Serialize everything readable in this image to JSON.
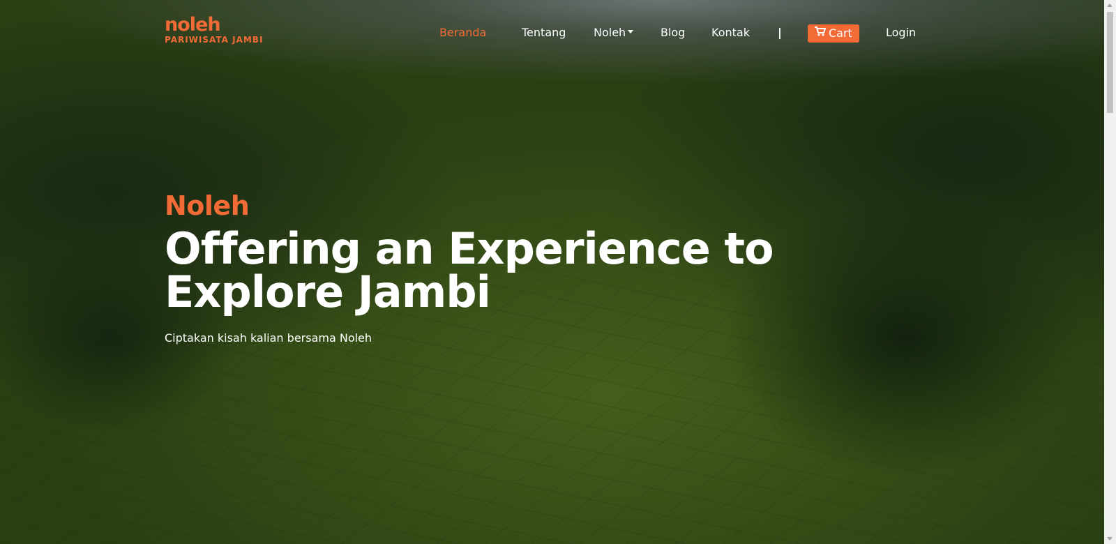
{
  "brand": {
    "logo_word": "noleh",
    "logo_sub": "PARIWISATA JAMBI",
    "accent_color": "#f26b37"
  },
  "nav": {
    "items": [
      {
        "label": "Beranda",
        "active": true
      },
      {
        "label": "Tentang",
        "active": false
      },
      {
        "label": "Noleh",
        "active": false,
        "dropdown": true
      },
      {
        "label": "Blog",
        "active": false
      },
      {
        "label": "Kontak",
        "active": false
      }
    ],
    "separator": "|",
    "cart_label": "Cart",
    "cart_icon": "shopping-cart-icon",
    "login_label": "Login"
  },
  "hero": {
    "brand": "Noleh",
    "title": "Offering an Experience to Explore Jambi",
    "subtitle": "Ciptakan kisah kalian bersama Noleh"
  }
}
